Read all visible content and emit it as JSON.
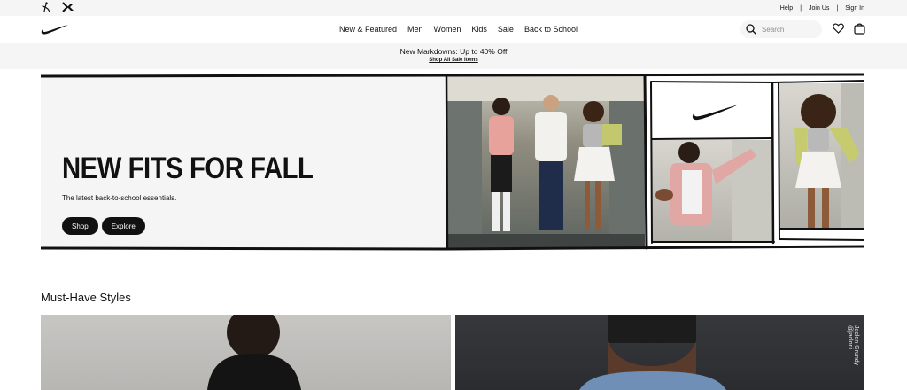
{
  "utility_bar": {
    "brand_icons": [
      "jordan-icon",
      "converse-icon"
    ],
    "links": [
      "Help",
      "Join Us",
      "Sign In"
    ]
  },
  "nav": {
    "logo_icon": "nike-swoosh-icon",
    "menu": [
      "New & Featured",
      "Men",
      "Women",
      "Kids",
      "Sale",
      "Back to School"
    ],
    "search_placeholder": "Search",
    "icons": [
      "search-icon",
      "heart-icon",
      "bag-icon"
    ]
  },
  "promo": {
    "title": "New Markdowns: Up to 40% Off",
    "link": "Shop All Sale Items"
  },
  "hero": {
    "title": "NEW FITS FOR FALL",
    "subtitle": "The latest back-to-school essentials.",
    "buttons": [
      "Shop",
      "Explore"
    ]
  },
  "section": {
    "title": "Must-Have Styles",
    "photo_credit": "Jaclon Grundy @jacloni"
  },
  "colors": {
    "accent": "#111111",
    "surface": "#f5f5f5"
  }
}
